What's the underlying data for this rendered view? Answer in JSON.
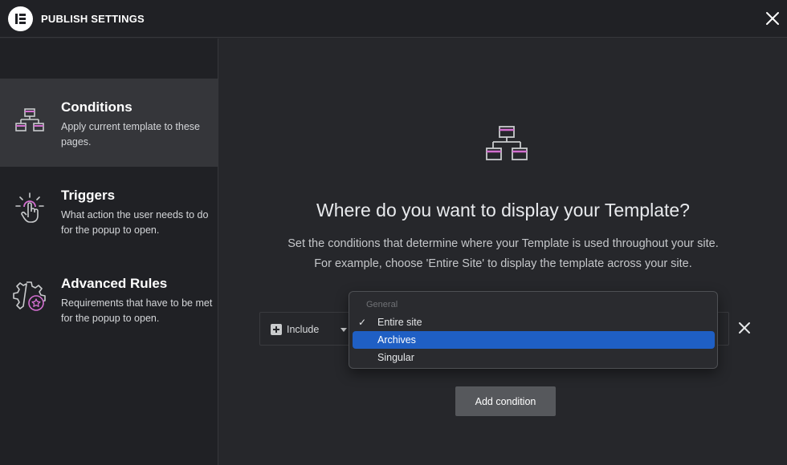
{
  "header": {
    "title": "PUBLISH SETTINGS"
  },
  "sidebar": {
    "items": [
      {
        "title": "Conditions",
        "desc": "Apply current template to these pages.",
        "icon": "sitemap-icon",
        "active": true
      },
      {
        "title": "Triggers",
        "desc": "What action the user needs to do for the popup to open.",
        "icon": "tap-icon",
        "active": false
      },
      {
        "title": "Advanced Rules",
        "desc": "Requirements that have to be met for the popup to open.",
        "icon": "gear-star-icon",
        "active": false
      }
    ]
  },
  "main": {
    "heading": "Where do you want to display your Template?",
    "subtext_line1": "Set the conditions that determine where your Template is used throughout your site.",
    "subtext_line2": "For example, choose 'Entire Site' to display the template across your site.",
    "condition": {
      "include_label": "Include"
    },
    "dropdown": {
      "group": "General",
      "options": [
        {
          "label": "Entire site",
          "checked": true,
          "highlighted": false
        },
        {
          "label": "Archives",
          "checked": false,
          "highlighted": true
        },
        {
          "label": "Singular",
          "checked": false,
          "highlighted": false
        }
      ]
    },
    "add_condition_label": "Add condition"
  },
  "colors": {
    "accent_pink": "#d36fd0",
    "icon_gray": "#c9cbcd",
    "highlight_blue": "#1f5fc4",
    "sidebar_bg": "#202125",
    "main_bg": "#26272b"
  }
}
